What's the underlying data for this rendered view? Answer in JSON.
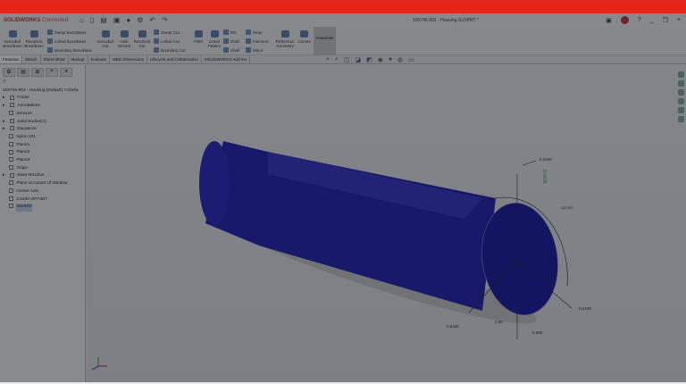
{
  "app": {
    "logo": "SOLIDWORKS",
    "logo_suffix": "Connected",
    "document_title": "100745-001 - Housing.SLDPRT *"
  },
  "window": {
    "help": "?",
    "minimize": "_",
    "restore": "❐",
    "close": "×"
  },
  "ribbon": {
    "big": [
      "Extruded Boss/Base",
      "Revolved Boss/Base",
      "Extruded Cut",
      "Hole Wizard",
      "Revolved Cut",
      "Fillet",
      "Linear Pattern",
      "Reference Geometry",
      "Curves",
      "Instant3D"
    ],
    "small": [
      "Swept Boss/Base",
      "Lofted Boss/Base",
      "Boundary Boss/Base",
      "Swept Cut",
      "Lofted Cut",
      "Boundary Cut",
      "Rib",
      "Draft",
      "Shell",
      "Wrap",
      "Intersect",
      "Mirror"
    ]
  },
  "tabs": [
    "Features",
    "Sketch",
    "Sheet Metal",
    "Markup",
    "Evaluate",
    "MBD Dimensions",
    "Lifecycle and Collaboration",
    "SOLIDWORKS Add-Ins"
  ],
  "tree": {
    "root": "100745-001 - Housing (Default) <<Defa",
    "items": [
      "Folder",
      "Annotations",
      "Sensors",
      "Solid Bodies(1)",
      "Equations",
      "Nylon 101",
      "Plane1",
      "Plane2",
      "Plane3",
      "Origin",
      "Base-Revolve",
      "Plane at Center of Window",
      "Center Axis",
      "2.6400 OFFSET",
      "Sketch2"
    ]
  },
  "dimensions": {
    "top": "0.2440",
    "left": "0.2440",
    "right": "0.2440",
    "bottom": "0.000",
    "small": "2.50",
    "angle": "120.00°",
    "green": "0.0979"
  },
  "colors": {
    "accent": "#e3261c",
    "part": "#1a1aa8"
  }
}
